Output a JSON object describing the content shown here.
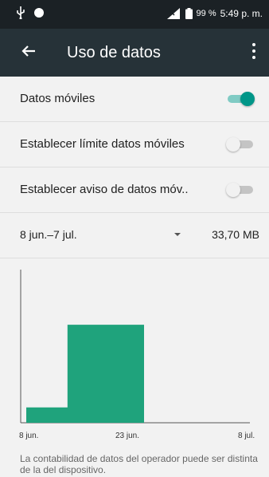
{
  "status_bar": {
    "battery_percent": "99 %",
    "time": "5:49 p. m."
  },
  "app_bar": {
    "title": "Uso de datos"
  },
  "settings": [
    {
      "label": "Datos móviles",
      "on": true
    },
    {
      "label": "Establecer límite datos móviles",
      "on": false
    },
    {
      "label": "Establecer aviso de datos móv..",
      "on": false
    }
  ],
  "cycle": {
    "range": "8 jun.–7 jul.",
    "usage": "33,70 MB"
  },
  "chart_data": {
    "type": "area",
    "x_ticks": [
      "8 jun.",
      "23 jun.",
      "8 jul."
    ],
    "x": [
      "8 jun.",
      "9 jun.",
      "10 jun.",
      "11 jun.",
      "12 jun.",
      "13 jun.",
      "14 jun.",
      "15 jun.",
      "16 jun.",
      "17 jun.",
      "18 jun.",
      "19 jun.",
      "20 jun.",
      "21 jun.",
      "22 jun.",
      "23 jun.",
      "24 jun.",
      "25 jun.",
      "26 jun.",
      "27 jun."
    ],
    "values": [
      0.1,
      0.1,
      0.1,
      0.1,
      0.1,
      0.1,
      0.1,
      0.64,
      0.64,
      0.64,
      0.64,
      0.64,
      0.64,
      0.64,
      0.64,
      0.64,
      0.64,
      0.64,
      0.64,
      0.64
    ],
    "color": "#1fa37c"
  },
  "footer_note": "La contabilidad de datos del operador puede ser distinta de la del dispositivo."
}
